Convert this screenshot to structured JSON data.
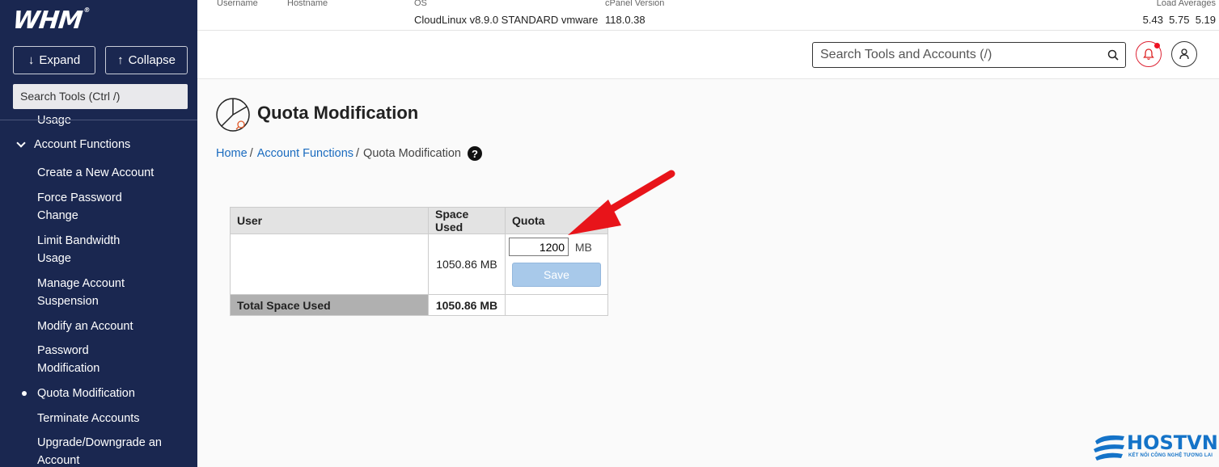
{
  "sidebar": {
    "logo": "WHM",
    "logo_mark": "®",
    "expand_label": "Expand",
    "collapse_label": "Collapse",
    "search_label": "Search Tools (Ctrl /)",
    "cut_item": "Usage",
    "group_label": "Account Functions",
    "items": [
      "Create a New Account",
      "Force Password Change",
      "Limit Bandwidth Usage",
      "Manage Account Suspension",
      "Modify an Account",
      "Password Modification",
      "Quota Modification",
      "Terminate Accounts",
      "Upgrade/Downgrade an Account"
    ],
    "active_item": "Quota Modification"
  },
  "topbar": {
    "username_label": "Username",
    "hostname_label": "Hostname",
    "os_label": "OS",
    "os_value": "CloudLinux v8.9.0 STANDARD vmware",
    "cpanel_label": "cPanel Version",
    "cpanel_value": "118.0.38",
    "load_label": "Load Averages",
    "load_value": "5.43  5.75  5.19"
  },
  "header": {
    "search_placeholder": "Search Tools and Accounts (/)"
  },
  "page": {
    "title": "Quota Modification",
    "breadcrumb": {
      "home": "Home",
      "sep": "/",
      "section": "Account Functions",
      "current": "Quota Modification",
      "help": "?"
    }
  },
  "table": {
    "headers": [
      "User",
      "Space Used",
      "Quota"
    ],
    "row": {
      "user": "",
      "space_used": "1050.86 MB",
      "quota_value": "1200",
      "quota_unit": "MB",
      "save_label": "Save"
    },
    "total": {
      "label": "Total Space Used",
      "value": "1050.86 MB"
    }
  },
  "watermark": {
    "brand": "HOSTVN",
    "tagline": "KẾT NỐI CÔNG NGHỆ TƯƠNG LAI"
  },
  "colors": {
    "sidebar_bg": "#1a2750",
    "link": "#1a6bbf",
    "save_button": "#a8c9ea",
    "arrow": "#e8141a",
    "notification": "#e12222",
    "watermark": "#1473c8"
  }
}
